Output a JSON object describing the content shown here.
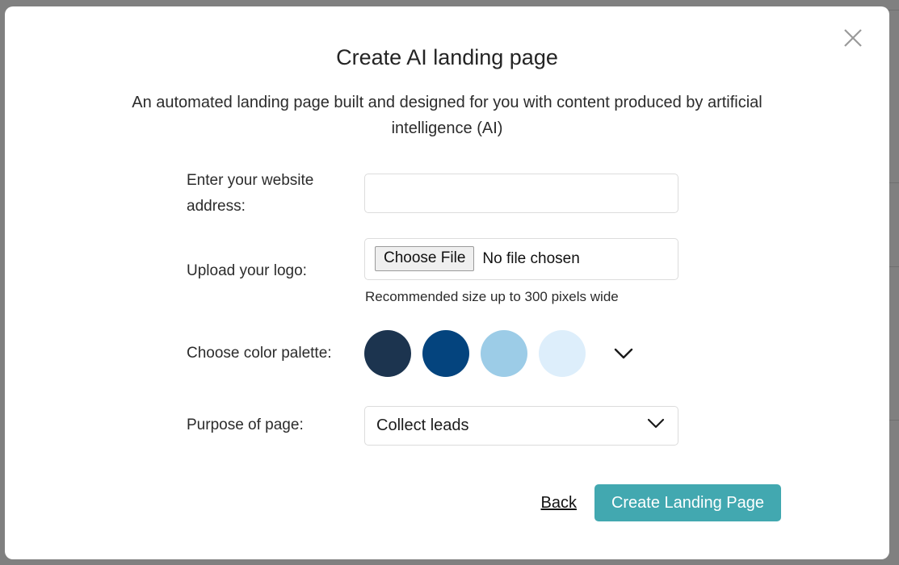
{
  "modal": {
    "title": "Create AI landing page",
    "subtitle": "An automated landing page built and designed for you with content produced by artificial intelligence (AI)",
    "close_icon": "close-icon"
  },
  "form": {
    "website": {
      "label": "Enter your website address:",
      "value": "",
      "placeholder": ""
    },
    "logo": {
      "label": "Upload your logo:",
      "button_label": "Choose File",
      "file_status": "No file chosen",
      "hint": "Recommended size up to 300 pixels wide"
    },
    "palette": {
      "label": "Choose color palette:",
      "swatches": [
        {
          "name": "swatch-dark-navy",
          "color": "#1c344f"
        },
        {
          "name": "swatch-deep-blue",
          "color": "#04447e"
        },
        {
          "name": "swatch-sky-blue",
          "color": "#9ccce7"
        },
        {
          "name": "swatch-pale-blue",
          "color": "#ddeefb"
        }
      ],
      "expand_icon": "chevron-down-icon"
    },
    "purpose": {
      "label": "Purpose of page:",
      "value": "Collect leads",
      "chevron_icon": "chevron-down-icon"
    }
  },
  "actions": {
    "back_label": "Back",
    "submit_label": "Create Landing Page",
    "submit_color": "#42a8b0"
  }
}
